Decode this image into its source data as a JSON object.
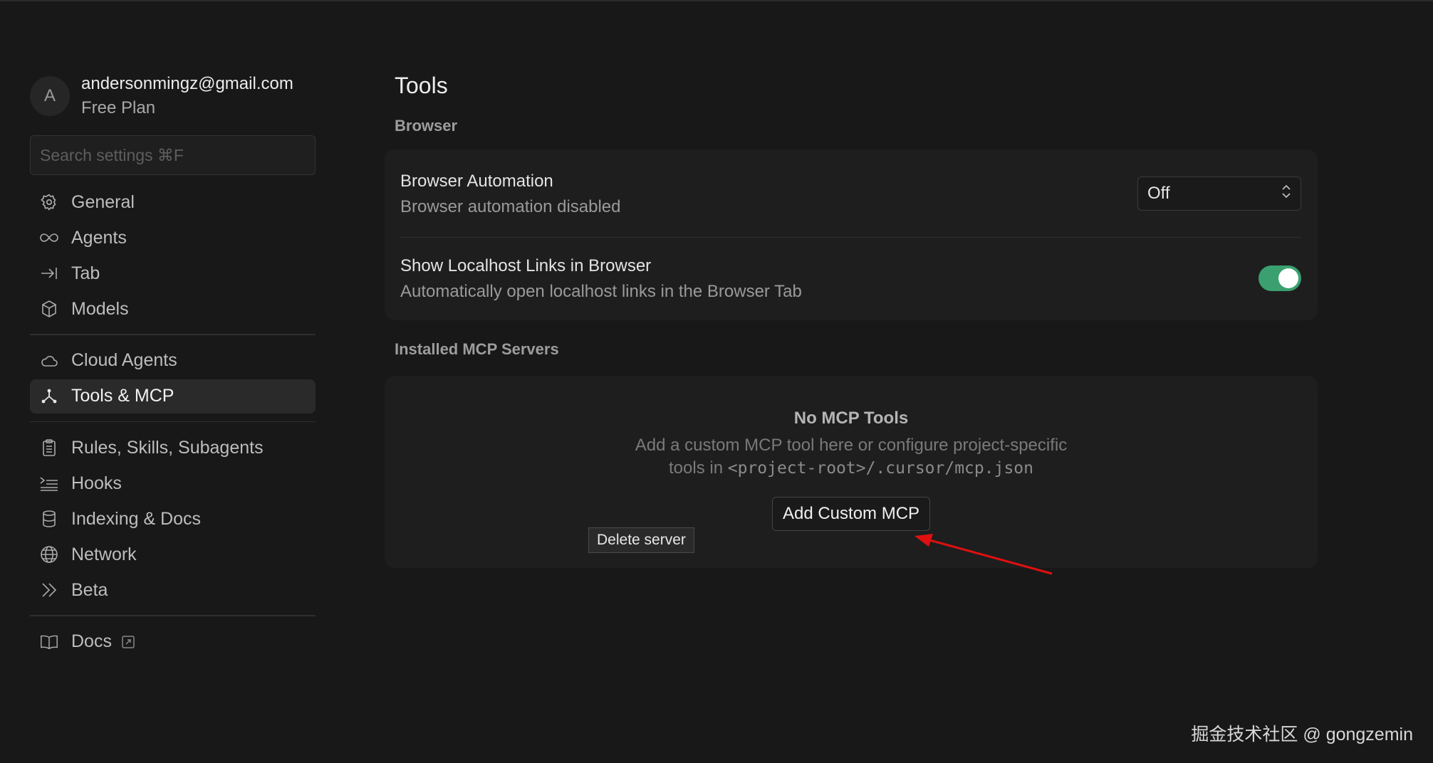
{
  "profile": {
    "avatar_initial": "A",
    "email": "andersonmingz@gmail.com",
    "plan": "Free Plan"
  },
  "search": {
    "placeholder": "Search settings ⌘F"
  },
  "sidebar": {
    "group1": [
      {
        "label": "General",
        "icon": "gear-icon"
      },
      {
        "label": "Agents",
        "icon": "infinity-icon"
      },
      {
        "label": "Tab",
        "icon": "arrow-to-line-icon"
      },
      {
        "label": "Models",
        "icon": "cube-icon"
      }
    ],
    "group2": [
      {
        "label": "Cloud Agents",
        "icon": "cloud-icon"
      },
      {
        "label": "Tools & MCP",
        "icon": "tools-node-icon",
        "active": true
      }
    ],
    "group3": [
      {
        "label": "Rules, Skills, Subagents",
        "icon": "clipboard-icon"
      },
      {
        "label": "Hooks",
        "icon": "hooks-list-icon"
      },
      {
        "label": "Indexing & Docs",
        "icon": "database-icon"
      },
      {
        "label": "Network",
        "icon": "globe-icon"
      },
      {
        "label": "Beta",
        "icon": "double-chevron-icon"
      }
    ],
    "group4": [
      {
        "label": "Docs",
        "icon": "book-icon"
      }
    ]
  },
  "main": {
    "title": "Tools",
    "browser_section": "Browser",
    "browser_automation": {
      "title": "Browser Automation",
      "desc": "Browser automation disabled",
      "value": "Off"
    },
    "localhost_links": {
      "title": "Show Localhost Links in Browser",
      "desc": "Automatically open localhost links in the Browser Tab",
      "enabled": true
    },
    "mcp_section": "Installed MCP Servers",
    "mcp_empty": {
      "title": "No MCP Tools",
      "desc_line1": "Add a custom MCP tool here or configure project-specific",
      "desc_line2_prefix": "tools in ",
      "desc_line2_code": "<project-root>/.cursor/mcp.json",
      "button": "Add Custom MCP"
    },
    "tooltip": "Delete server"
  },
  "colors": {
    "background": "#181818",
    "card": "#1e1e1e",
    "toggle_on": "#3aa070",
    "annotation_arrow": "#e01010"
  },
  "watermark": "掘金技术社区 @ gongzemin"
}
